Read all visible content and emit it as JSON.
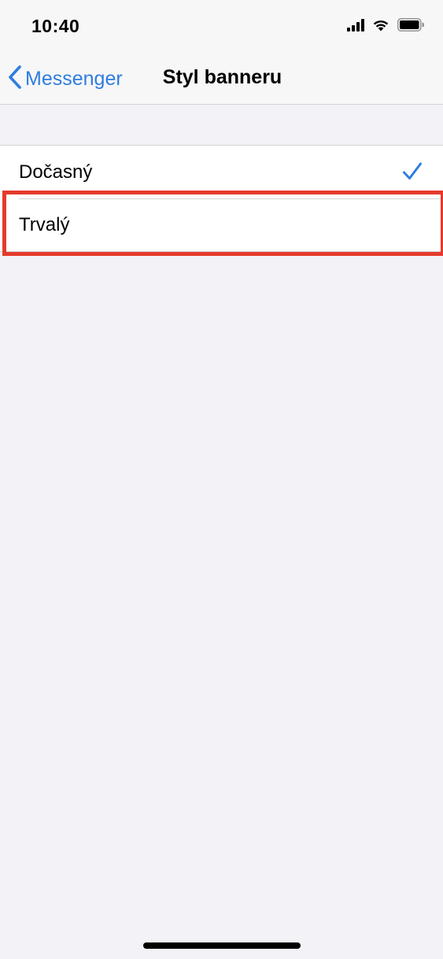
{
  "status_bar": {
    "time": "10:40",
    "icons": [
      "cellular-signal-icon",
      "wifi-icon",
      "battery-icon"
    ]
  },
  "nav": {
    "back_label": "Messenger",
    "back_icon": "chevron-left-icon",
    "title": "Styl banneru"
  },
  "options": [
    {
      "label": "Dočasný",
      "selected": true
    },
    {
      "label": "Trvalý",
      "selected": false
    }
  ],
  "colors": {
    "accent": "#2f7de1",
    "highlight": "#e53a2b",
    "background": "#f2f2f7"
  }
}
